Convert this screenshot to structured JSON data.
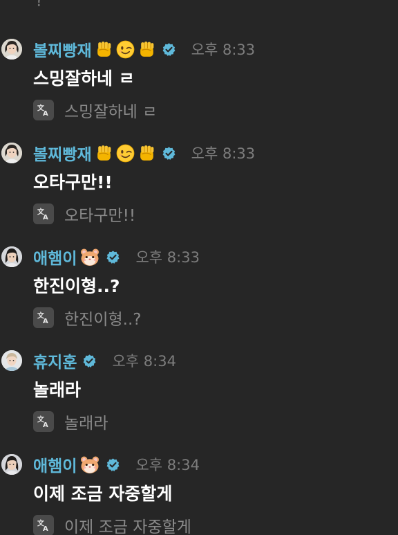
{
  "colors": {
    "background": "#262626",
    "username": "#5fb9da",
    "message": "#ffffff",
    "timestamp": "#7d7d7d",
    "translated": "#8a8a8a",
    "verified_badge": "#5fb9da",
    "translate_icon_bg": "#4a4a4a"
  },
  "top_cut_text": "?",
  "messages": [
    {
      "username": "볼찌빵재",
      "emojis": [
        "raised-fist-icon",
        "winking-face-icon",
        "raised-fist-icon"
      ],
      "verified": true,
      "time": "오후 8:33",
      "text": "스밍잘하네 ㄹ",
      "translation": "스밍잘하네 ㄹ"
    },
    {
      "username": "볼찌빵재",
      "emojis": [
        "raised-fist-icon",
        "winking-face-icon",
        "raised-fist-icon"
      ],
      "verified": true,
      "time": "오후 8:33",
      "text": "오타구만!!",
      "translation": "오타구만!!"
    },
    {
      "username": "애햄이",
      "emojis": [
        "hamster-face-icon"
      ],
      "verified": true,
      "time": "오후 8:33",
      "text": "한진이형..?",
      "translation": "한진이형..?"
    },
    {
      "username": "휴지훈",
      "emojis": [],
      "verified": true,
      "time": "오후 8:34",
      "text": "놀래라",
      "translation": "놀래라"
    },
    {
      "username": "애햄이",
      "emojis": [
        "hamster-face-icon"
      ],
      "verified": true,
      "time": "오후 8:34",
      "text": "이제 조금 자중할게",
      "translation": "이제 조금 자중할게"
    }
  ]
}
